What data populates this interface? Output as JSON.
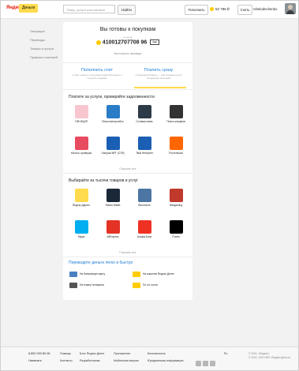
{
  "header": {
    "logo": "Яндекс",
    "badge": "Деньги",
    "search_placeholder": "Товар, услуга или магазин",
    "search_button": "Найти",
    "topup_button": "Пополнить",
    "balance": "52 786 ₽",
    "send_button": "Снять",
    "username": "rshelodnchenko"
  },
  "sidebar": {
    "items": [
      "Операции",
      "Переводы",
      "Товары и услуги",
      "Правила платежей"
    ]
  },
  "hero": {
    "title": "Вы готовы к покупкам",
    "subtitle": "кошелёк",
    "account": "410012707708 96",
    "qr_label": "Ещё",
    "link": "Как получить переводы"
  },
  "tabs": {
    "left": {
      "label": "Пополнить счет",
      "sub": "Чтобы платить в интернете даже без карты и получать подарки"
    },
    "right": {
      "label": "Платить сразу",
      "sub": "С банковской карты — или сохраните для следующих платежей"
    }
  },
  "services": {
    "title": "Платите за услуги, проверяйте задолженности",
    "items": [
      {
        "label": "ГИБ ВЦИП",
        "icon": "gibdd-icon",
        "color": "#f7c6cf"
      },
      {
        "label": "Петроэлектросбыт",
        "icon": "petroelektrosbyt-icon",
        "color": "#2a7cc7"
      },
      {
        "label": "Сотовая связь",
        "icon": "phone-icon",
        "color": "#2d3a47"
      },
      {
        "label": "Поиск штрафов",
        "icon": "car-icon",
        "color": "#333333"
      },
      {
        "label": "Налоги, проверка",
        "icon": "tax-icon",
        "color": "#e84a5f"
      },
      {
        "label": "Газпром МРГ (СПб)",
        "icon": "gazprom-icon",
        "color": "#1a5fb4"
      },
      {
        "label": "Твой Интернет",
        "icon": "internet-icon",
        "color": "#1a5fb4"
      },
      {
        "label": "Ростелеком",
        "icon": "rostelecom-icon",
        "color": "#ff6600"
      }
    ],
    "show_all": "Показать все"
  },
  "shops": {
    "title": "Выбирайте из тысячи товаров и услуг",
    "items": [
      {
        "label": "Яндекс.Директ",
        "icon": "yandex-direct-icon",
        "color": "#ffdb4d"
      },
      {
        "label": "Steam Wallet",
        "icon": "steam-icon",
        "color": "#1b2838"
      },
      {
        "label": "ВКонтакте",
        "icon": "vk-icon",
        "color": "#4c75a3"
      },
      {
        "label": "Wargaming",
        "icon": "wargaming-icon",
        "color": "#c0392b"
      },
      {
        "label": "Skype",
        "icon": "skype-icon",
        "color": "#00aff0"
      },
      {
        "label": "AliExpress",
        "icon": "aliexpress-icon",
        "color": "#e43225"
      },
      {
        "label": "Альфа-Банк",
        "icon": "alfabank-icon",
        "color": "#ef3124"
      },
      {
        "label": "iTunes",
        "icon": "itunes-icon",
        "color": "#000000"
      }
    ],
    "show_all": "Показать все"
  },
  "transfers": {
    "title": "Переводите деньги легко и быстро",
    "items": [
      {
        "label": "На банковскую карту",
        "icon": "bank-card-icon",
        "color": "#4a7fc1"
      },
      {
        "label": "На кошелек Яндекс.Денег",
        "icon": "wallet-icon",
        "color": "#ffcc00"
      },
      {
        "label": "На номер телефона",
        "icon": "mobile-icon",
        "color": "#555555"
      },
      {
        "label": "По эл. почте",
        "icon": "email-icon",
        "color": "#ffcc00"
      }
    ]
  },
  "footer": {
    "phone": "8 800 333 80 06",
    "chat": "Написать",
    "col1": [
      "Помощь",
      "Контакты"
    ],
    "col2": [
      "Блог Яндекс.Денег",
      "Разработчикам"
    ],
    "col3": [
      "Приложения",
      "Мобильная версия"
    ],
    "col4": [
      "Безопасность",
      "Юридическая информация"
    ],
    "lang": "Ru",
    "copyright1": "© 2016, «Яндекс»",
    "copyright2": "© 2016, ООО НКО «Яндекс.Деньги»"
  }
}
